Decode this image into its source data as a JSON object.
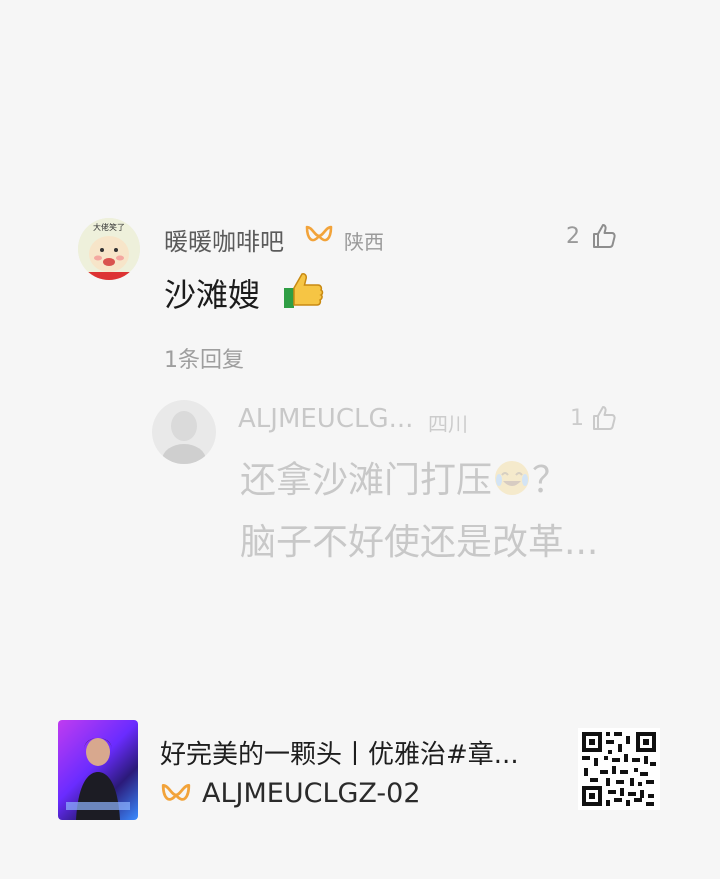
{
  "comment": {
    "username": "暖暖咖啡吧",
    "location": "陕西",
    "likes": "2",
    "text": "沙滩嫂",
    "emoji": "thumbs-up-emoji",
    "avatar_text": "大佬笑了",
    "reply_count_label": "1条回复"
  },
  "reply": {
    "username": "ALJMEUCLG...",
    "location": "四川",
    "likes": "1",
    "text_line1": "还拿沙滩门打压",
    "text_line1_end": "？",
    "text_line2": "脑子不好使还是改革...",
    "emoji": "crying-laughing-emoji"
  },
  "footer": {
    "title": "好完美的一颗头丨优雅治#章...",
    "author": "ALJMEUCLGZ-02",
    "icons": [
      "creator-badge-icon",
      "qr-code-icon"
    ]
  },
  "colors": {
    "background": "#f6f6f6",
    "badge_orange": "#f2a33a",
    "text_primary": "#1b1b1b",
    "text_secondary": "#9a9a9a"
  }
}
